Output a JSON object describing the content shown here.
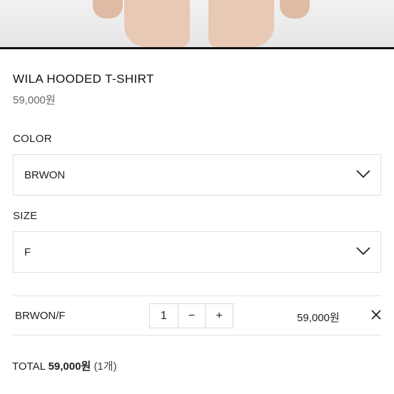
{
  "product": {
    "name": "WILA HOODED T-SHIRT",
    "price": "59,000원"
  },
  "color": {
    "label": "COLOR",
    "selected": "BRWON"
  },
  "size": {
    "label": "SIZE",
    "selected": "F"
  },
  "selection": {
    "option": "BRWON/F",
    "quantity": "1",
    "decrement": "−",
    "increment": "+",
    "price": "59,000원",
    "remove": "✕"
  },
  "total": {
    "label": "TOTAL",
    "amount": "59,000원",
    "count": "(1개)"
  },
  "icons": {
    "dropdown": "chevron-down-icon",
    "remove": "close-icon"
  }
}
